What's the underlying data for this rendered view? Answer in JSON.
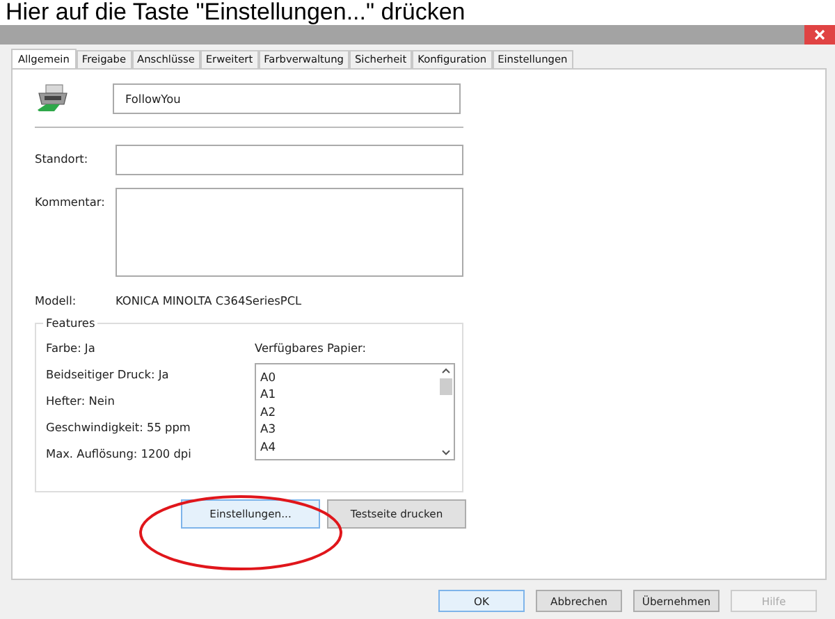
{
  "caption": "Hier auf die Taste \"Einstellungen...\" drücken",
  "tabs": [
    {
      "label": "Allgemein",
      "selected": true
    },
    {
      "label": "Freigabe",
      "selected": false
    },
    {
      "label": "Anschlüsse",
      "selected": false
    },
    {
      "label": "Erweitert",
      "selected": false
    },
    {
      "label": "Farbverwaltung",
      "selected": false
    },
    {
      "label": "Sicherheit",
      "selected": false
    },
    {
      "label": "Konfiguration",
      "selected": false
    },
    {
      "label": "Einstellungen",
      "selected": false
    }
  ],
  "general": {
    "printer_name": "FollowYou",
    "location_label": "Standort:",
    "comment_label": "Kommentar:",
    "model_label": "Modell:",
    "model_value": "KONICA MINOLTA C364SeriesPCL"
  },
  "features": {
    "title": "Features",
    "items": [
      "Farbe: Ja",
      "Beidseitiger Druck: Ja",
      "Hefter: Nein",
      "Geschwindigkeit: 55 ppm",
      "Max. Auflösung: 1200 dpi"
    ],
    "paper_label": "Verfügbares Papier:",
    "paper_list": [
      "A0",
      "A1",
      "A2",
      "A3",
      "A4"
    ]
  },
  "actions": [
    {
      "label": "Einstellungen...",
      "focused": true
    },
    {
      "label": "Testseite drucken",
      "focused": false
    }
  ],
  "dialog_buttons": [
    {
      "label": "OK",
      "disabled": false,
      "focused": true
    },
    {
      "label": "Abbrechen",
      "disabled": false,
      "focused": false
    },
    {
      "label": "Übernehmen",
      "disabled": false,
      "focused": false
    },
    {
      "label": "Hilfe",
      "disabled": true,
      "focused": false
    }
  ]
}
